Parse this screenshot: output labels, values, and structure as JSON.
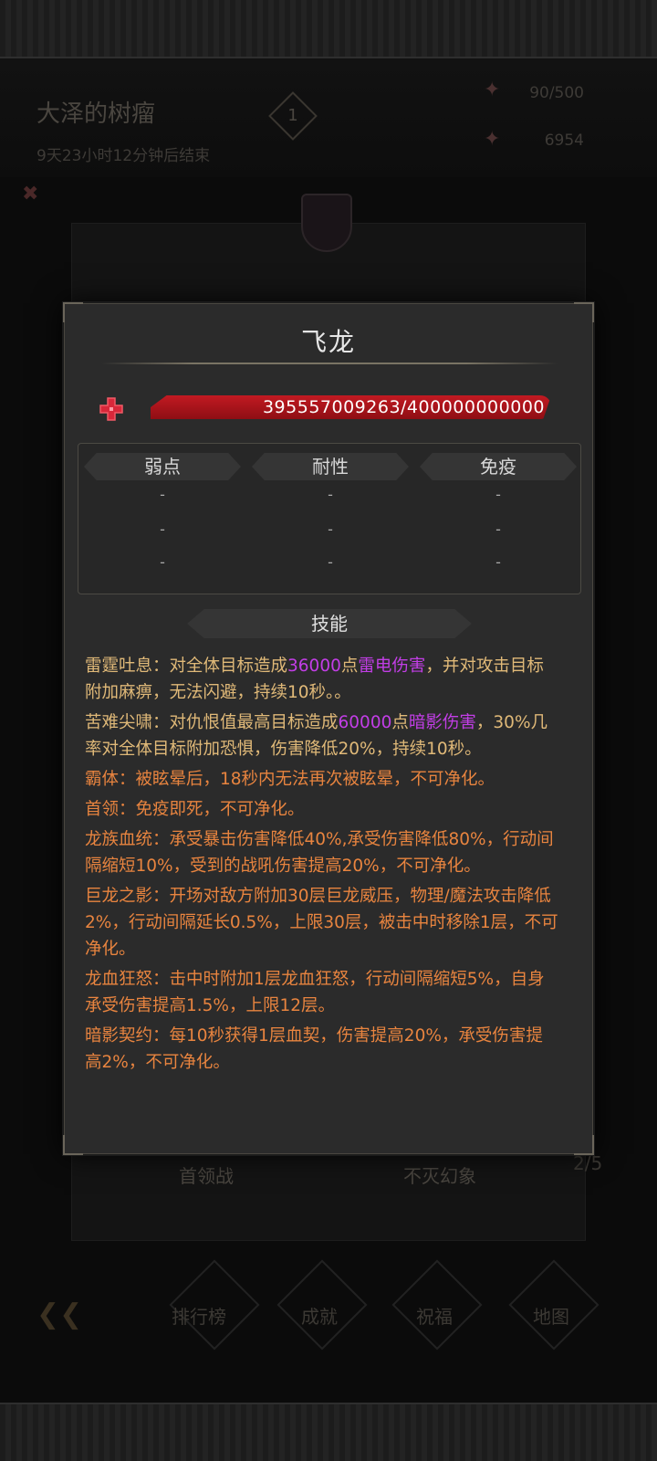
{
  "background": {
    "event_title": "大泽的树瘤",
    "event_timer": "9天23小时12分钟后结束",
    "level": "1",
    "resource_1": "90/500",
    "resource_2": "6954",
    "tab_boss_battle": "首领战",
    "tab_phantom": "不灭幻象",
    "page_count": "2/5",
    "nav_ranking": "排行榜",
    "nav_achievement": "成就",
    "nav_blessing": "祝福",
    "nav_map": "地图"
  },
  "modal": {
    "title": "飞龙",
    "hp_value": "395557009263/400000000000",
    "hp_fraction": 0.9889,
    "resistances": {
      "weak_label": "弱点",
      "resist_label": "耐性",
      "immune_label": "免疫",
      "weak": [
        "-",
        "-",
        "-"
      ],
      "resist": [
        "-",
        "-",
        "-"
      ],
      "immune": [
        "-",
        "-",
        "-"
      ]
    },
    "skills_label": "技能",
    "skills": [
      {
        "parts": [
          {
            "text": "雷霆吐息：对全体目标造成",
            "color": "yellow"
          },
          {
            "text": "36000",
            "color": "purple"
          },
          {
            "text": "点",
            "color": "yellow"
          },
          {
            "text": "雷电伤害",
            "color": "purple"
          },
          {
            "text": "，并对攻击目标附加麻痹，无法闪避，持续10秒。。",
            "color": "yellow"
          }
        ]
      },
      {
        "parts": [
          {
            "text": "苦难尖啸：对仇恨值最高目标造成",
            "color": "yellow"
          },
          {
            "text": "60000",
            "color": "purple"
          },
          {
            "text": "点",
            "color": "yellow"
          },
          {
            "text": "暗影伤害",
            "color": "purple"
          },
          {
            "text": "，30%几率对全体目标附加恐惧，伤害降低20%，持续10秒。",
            "color": "yellow"
          }
        ]
      },
      {
        "parts": [
          {
            "text": "霸体：被眩晕后，18秒内无法再次被眩晕，不可净化。",
            "color": "orange"
          }
        ]
      },
      {
        "parts": [
          {
            "text": "首领：免疫即死，不可净化。",
            "color": "orange"
          }
        ]
      },
      {
        "parts": [
          {
            "text": "龙族血统：承受暴击伤害降低40%,承受伤害降低80%，行动间隔缩短10%，受到的战吼伤害提高20%，不可净化。",
            "color": "orange"
          }
        ]
      },
      {
        "parts": [
          {
            "text": "巨龙之影：开场对敌方附加30层巨龙威压，物理/魔法攻击降低2%，行动间隔延长0.5%，上限30层，被击中时移除1层，不可净化。",
            "color": "orange"
          }
        ]
      },
      {
        "parts": [
          {
            "text": "龙血狂怒：击中时附加1层龙血狂怒，行动间隔缩短5%，自身承受伤害提高1.5%，上限12层。",
            "color": "orange"
          }
        ]
      },
      {
        "parts": [
          {
            "text": "暗影契约：每10秒获得1层血契，伤害提高20%，承受伤害提高2%，不可净化。",
            "color": "orange"
          }
        ]
      }
    ]
  }
}
